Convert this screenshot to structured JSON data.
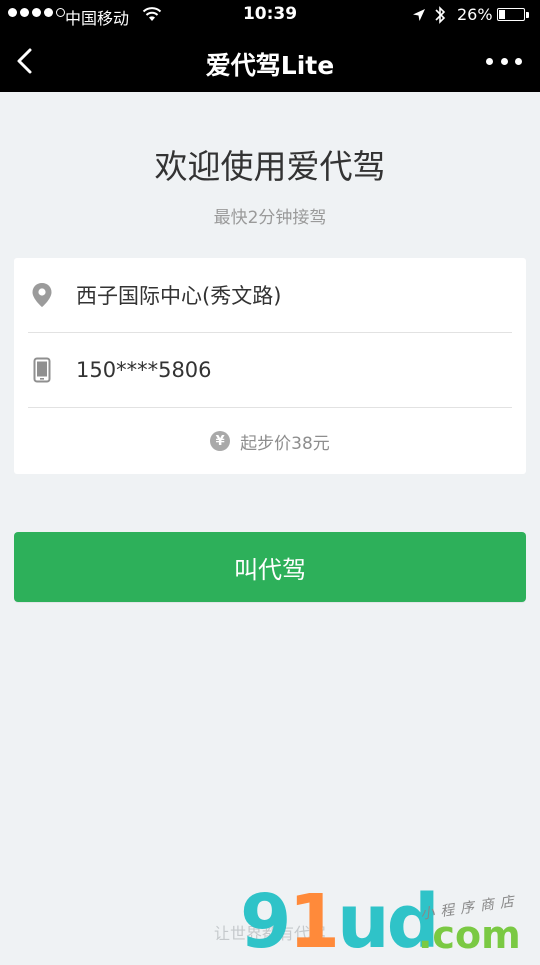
{
  "status_bar": {
    "carrier": "中国移动",
    "time": "10:39",
    "battery_percent": "26%",
    "battery_level": 0.26,
    "icons": [
      "signal-dots-icon",
      "wifi-icon",
      "location-arrow-icon",
      "bluetooth-icon",
      "battery-icon"
    ]
  },
  "nav": {
    "title": "爱代驾Lite",
    "back_icon": "chevron-left-icon",
    "more_icon": "more-dots-icon"
  },
  "main": {
    "welcome": "欢迎使用爱代驾",
    "subtitle": "最快2分钟接驾"
  },
  "form": {
    "address": {
      "icon": "location-pin-icon",
      "value": "西子国际中心(秀文路)"
    },
    "phone": {
      "icon": "phone-icon",
      "value": "150****5806"
    },
    "price": {
      "icon": "yen-icon",
      "icon_text": "¥",
      "label": "起步价38元"
    }
  },
  "actions": {
    "call_label": "叫代驾"
  },
  "footer": {
    "text": "让世界都有代驾"
  },
  "watermark": {
    "logo_g": "9",
    "logo_1": "1",
    "logo_ud": "ud",
    "dotcom": ".com",
    "slogan": "小程序商店"
  },
  "colors": {
    "nav_background": "#000000",
    "page_background": "#eff2f4",
    "accent_green": "#2db05a",
    "text_primary": "#333333",
    "text_secondary": "#9a9a9a"
  }
}
